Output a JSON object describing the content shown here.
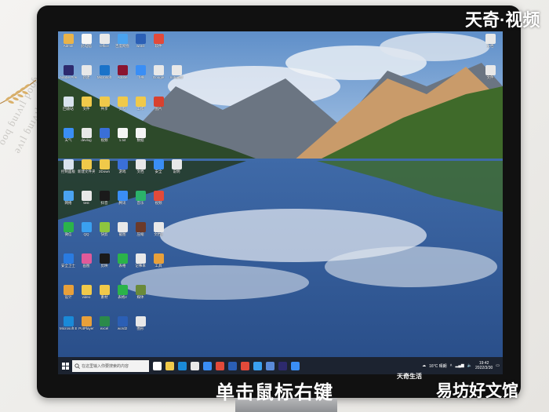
{
  "watermark_top": "天奇·视频",
  "caption": "单击鼠标右键",
  "watermark_brand_small": "天奇生活",
  "watermark_bottom": "易坊好文馆",
  "background_book_text": [
    "ooq ɓuıʌıl pooɓ",
    "ǝʌıl ɓuıʌıl"
  ],
  "taskbar": {
    "search_placeholder": "在这里输入你要搜索的内容",
    "weather": "16°C 晴朗",
    "time": "19:42",
    "date": "2022/3/30"
  },
  "desktop_icons": [
    {
      "label": "Admin",
      "color": "#e9b34a"
    },
    {
      "label": "此电脑",
      "color": "#f5f5f5"
    },
    {
      "label": "Office",
      "color": "#e8e8e8"
    },
    {
      "label": "百度网盘",
      "color": "#4aa3f0"
    },
    {
      "label": "word",
      "color": "#2b5fb5"
    },
    {
      "label": "软件",
      "color": "#e24a3a"
    },
    {
      "label": "Adobe Premiere",
      "color": "#2d2a6e"
    },
    {
      "label": "新建",
      "color": "#e8e8e8"
    },
    {
      "label": "Microsoft",
      "color": "#1a73c9"
    },
    {
      "label": "Adobe",
      "color": "#8a1430"
    },
    {
      "label": "飞书",
      "color": "#3a8ef5"
    },
    {
      "label": "Google",
      "color": "#e8e8e8"
    },
    {
      "label": "notepad",
      "color": "#e8e8e8"
    },
    {
      "label": "回收站",
      "color": "#d9e3ee"
    },
    {
      "label": "文件",
      "color": "#f0c94a"
    },
    {
      "label": "共享",
      "color": "#f0c94a"
    },
    {
      "label": "资料",
      "color": "#f0c94a"
    },
    {
      "label": "工作",
      "color": "#f0c94a"
    },
    {
      "label": "图片",
      "color": "#d8412f"
    },
    {
      "label": "天气",
      "color": "#3a8ef5"
    },
    {
      "label": "devlog",
      "color": "#e8e8e8"
    },
    {
      "label": "视频",
      "color": "#3a6fd8"
    },
    {
      "label": "1.txt",
      "color": "#f5f5f5"
    },
    {
      "label": "数据",
      "color": "#f5f5f5"
    },
    {
      "label": "控制面板",
      "color": "#d9e3ee"
    },
    {
      "label": "新建文件夹",
      "color": "#f0c94a"
    },
    {
      "label": "2Down",
      "color": "#f0c94a"
    },
    {
      "label": "游戏",
      "color": "#3a6fd8"
    },
    {
      "label": "文档",
      "color": "#e8e8e8"
    },
    {
      "label": "安全",
      "color": "#3a8ef5"
    },
    {
      "label": "说明",
      "color": "#e8e8e8"
    },
    {
      "label": "网络",
      "color": "#4aa3f0"
    },
    {
      "label": "test",
      "color": "#e8e8e8"
    },
    {
      "label": "抖音",
      "color": "#1a1a1a"
    },
    {
      "label": "腾讯",
      "color": "#3a8ef5"
    },
    {
      "label": "音乐",
      "color": "#2bb36a"
    },
    {
      "label": "视频",
      "color": "#e24a3a"
    },
    {
      "label": "微信",
      "color": "#2bb34a"
    },
    {
      "label": "QQ",
      "color": "#3aa0f0"
    },
    {
      "label": "快剪",
      "color": "#8ec63f"
    },
    {
      "label": "截图",
      "color": "#e8e8e8"
    },
    {
      "label": "压缩",
      "color": "#6b3a2a"
    },
    {
      "label": "文档2",
      "color": "#e8e8e8"
    },
    {
      "label": "安全卫士",
      "color": "#2a7be0"
    },
    {
      "label": "画图",
      "color": "#e05a9a"
    },
    {
      "label": "剪映",
      "color": "#1a1a1a"
    },
    {
      "label": "表格",
      "color": "#2bb34a"
    },
    {
      "label": "记事本",
      "color": "#e8e8e8"
    },
    {
      "label": "工具",
      "color": "#e8a03a"
    },
    {
      "label": "设计",
      "color": "#e8a03a"
    },
    {
      "label": "video",
      "color": "#f0c94a"
    },
    {
      "label": "素材",
      "color": "#f0c94a"
    },
    {
      "label": "表格2",
      "color": "#2bb34a"
    },
    {
      "label": "媒体",
      "color": "#6a8a3a"
    },
    {
      "label": "Microsoft Edge",
      "color": "#1a8ad8"
    },
    {
      "label": "PotPlayer",
      "color": "#e8a03a"
    },
    {
      "label": "excel",
      "color": "#2b8a4a"
    },
    {
      "label": "word2",
      "color": "#2b5fb5"
    },
    {
      "label": "图形",
      "color": "#e8e8e8"
    }
  ],
  "right_icons": [
    {
      "label": "文档",
      "color": "#e8e8e8"
    },
    {
      "label": "文件",
      "color": "#e8e8e8"
    }
  ],
  "taskbar_apps": [
    {
      "name": "task-view",
      "color": "#ffffff"
    },
    {
      "name": "explorer",
      "color": "#f0c94a"
    },
    {
      "name": "edge",
      "color": "#1a8ad8"
    },
    {
      "name": "chrome",
      "color": "#e8e8e8"
    },
    {
      "name": "mail",
      "color": "#3a8ef5"
    },
    {
      "name": "wps",
      "color": "#e24a3a"
    },
    {
      "name": "word",
      "color": "#2b5fb5"
    },
    {
      "name": "netease",
      "color": "#e24a3a"
    },
    {
      "name": "qq",
      "color": "#3aa0f0"
    },
    {
      "name": "photo",
      "color": "#5a8ad8"
    },
    {
      "name": "premiere",
      "color": "#2d2a6e"
    },
    {
      "name": "browser",
      "color": "#3a8ef5"
    }
  ]
}
